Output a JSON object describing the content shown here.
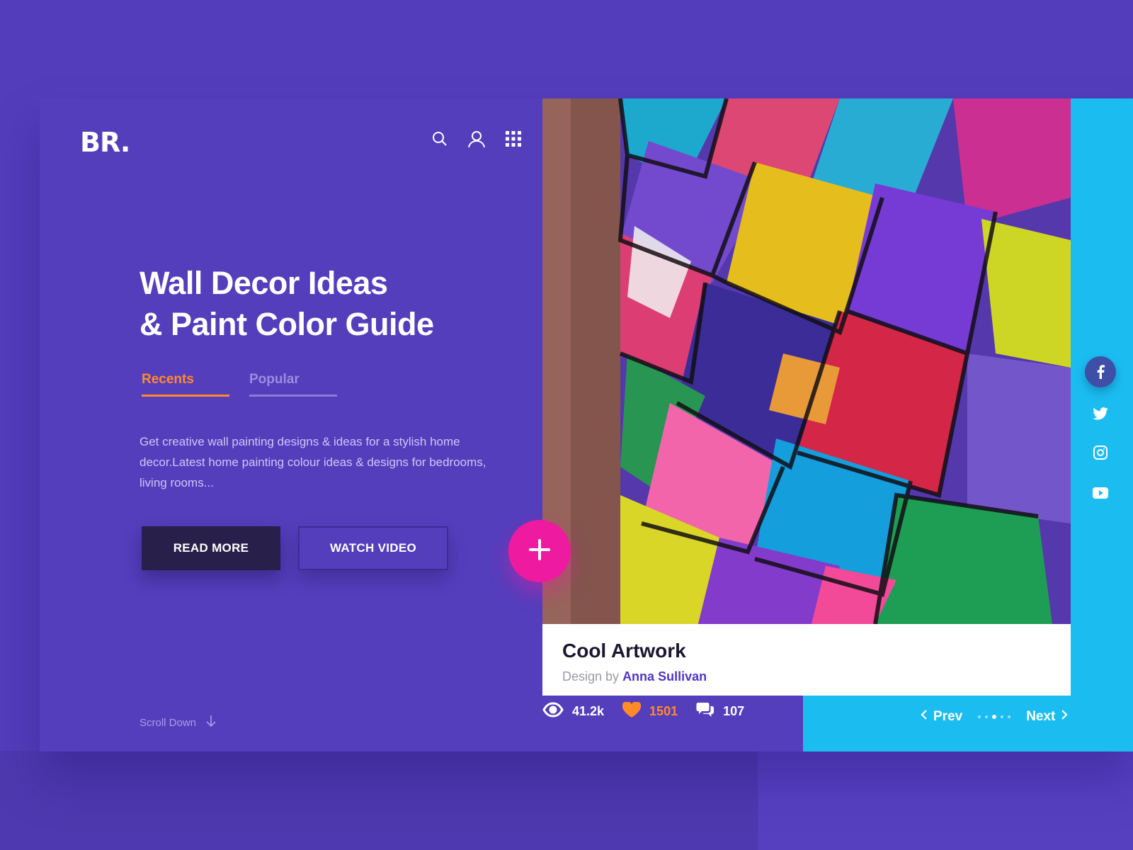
{
  "brand": {
    "logo": "BR."
  },
  "header": {
    "icons": [
      "search-icon",
      "user-icon",
      "grid-icon"
    ]
  },
  "hero": {
    "title_line1": "Wall Decor Ideas",
    "title_line2": "& Paint Color Guide",
    "tabs": [
      {
        "label": "Recents",
        "active": true
      },
      {
        "label": "Popular",
        "active": false
      }
    ],
    "description": "Get creative wall painting designs & ideas for a stylish home decor.Latest home painting colour ideas & designs for bedrooms, living rooms...",
    "primary_button": "READ MORE",
    "secondary_button": "WATCH VIDEO",
    "scroll_label": "Scroll Down"
  },
  "artwork": {
    "title": "Cool Artwork",
    "byline_prefix": "Design by",
    "author": "Anna Sullivan",
    "add_icon": "plus-icon"
  },
  "stats": {
    "views": "41.2k",
    "likes": "1501",
    "comments": "107"
  },
  "pager": {
    "prev": "Prev",
    "next": "Next",
    "dots": 5,
    "active_dot": 3
  },
  "social": [
    "facebook-icon",
    "twitter-icon",
    "instagram-icon",
    "youtube-icon"
  ],
  "colors": {
    "background": "#533dbb",
    "accent_orange": "#ff8a2a",
    "accent_pink": "#ee1aa0",
    "accent_cyan": "#1bbdf1",
    "dark_button": "#28204a",
    "author_link": "#4f34c8"
  }
}
